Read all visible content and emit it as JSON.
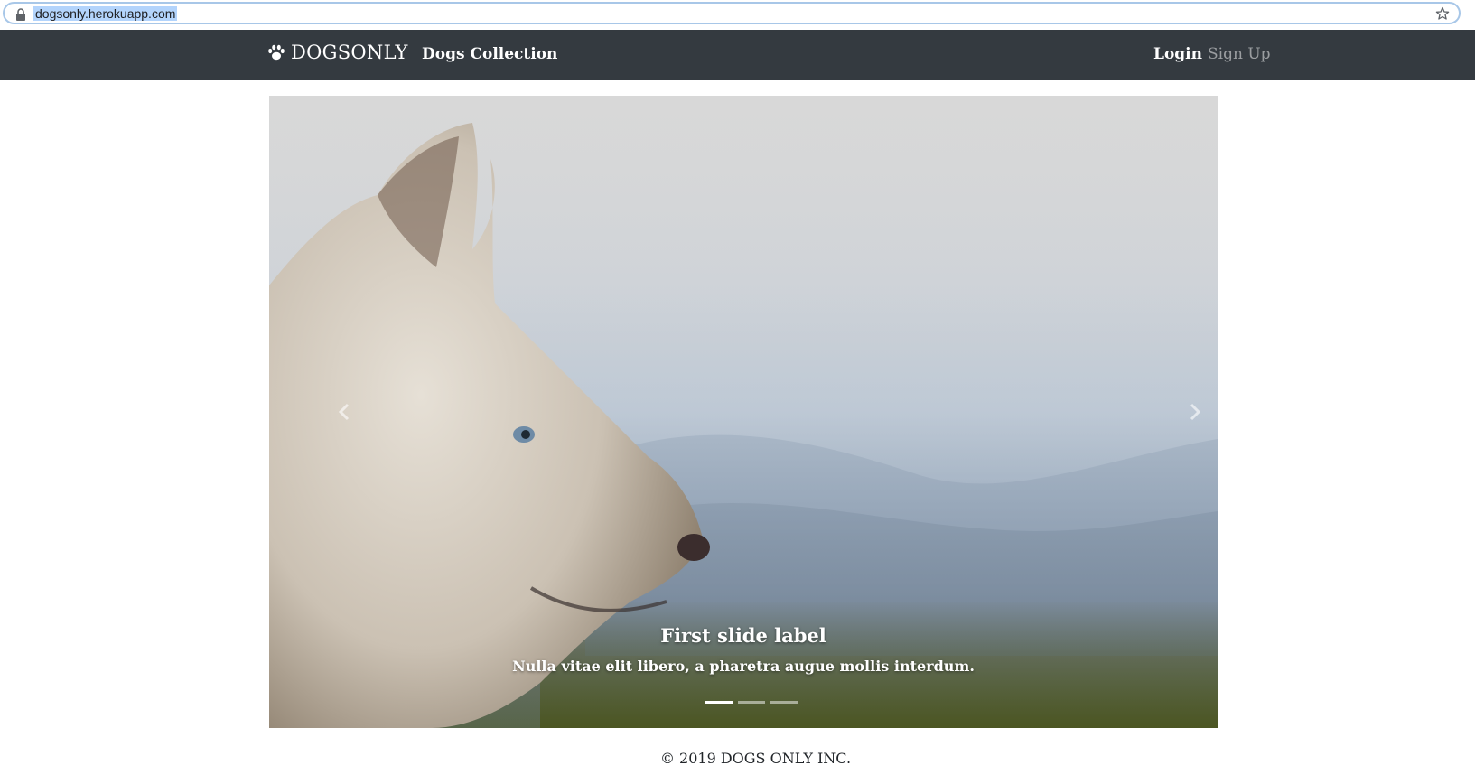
{
  "browser": {
    "url": "dogsonly.herokuapp.com",
    "icons": [
      "lock-icon",
      "star-icon"
    ]
  },
  "navbar": {
    "brand": "DOGSONLY",
    "brand_icon": "paw-icon",
    "collection_link": "Dogs Collection",
    "login_link": "Login",
    "signup_link": "Sign Up"
  },
  "carousel": {
    "caption_title": "First slide label",
    "caption_text": "Nulla vitae elit libero, a pharetra augue mollis interdum.",
    "slide_count": 3,
    "active_slide": 1,
    "prev_icon": "chevron-left-icon",
    "next_icon": "chevron-right-icon"
  },
  "footer": {
    "copyright": "© 2019 DOGS ONLY INC."
  },
  "colors": {
    "navbar_bg": "#343a40",
    "nav_text": "#ffffff",
    "nav_muted": "#9a9da0"
  }
}
